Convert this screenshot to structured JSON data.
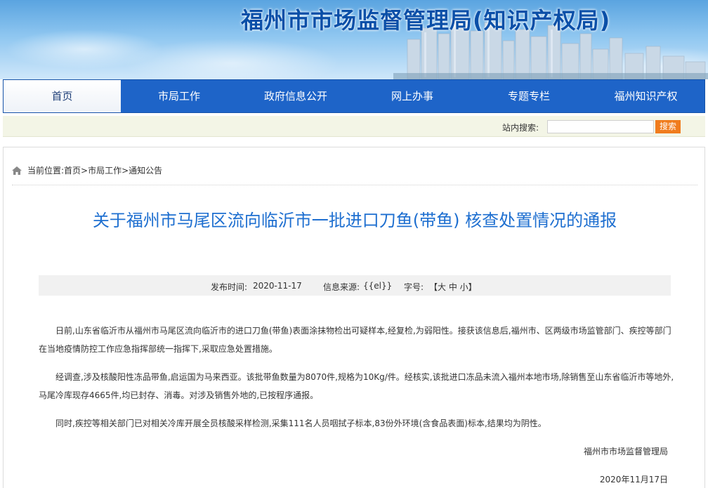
{
  "header": {
    "site_title": "福州市市场监督管理局(知识产权局)"
  },
  "nav": {
    "items": [
      "首页",
      "市局工作",
      "政府信息公开",
      "网上办事",
      "专题专栏",
      "福州知识产权"
    ]
  },
  "search": {
    "label": "站内搜索:",
    "value": "",
    "button": "搜索"
  },
  "breadcrumb": {
    "prefix": "当前位置:",
    "path": "首页>市局工作>通知公告"
  },
  "article": {
    "title": "关于福州市马尾区流向临沂市一批进口刀鱼(带鱼) 核查处置情况的通报",
    "meta": {
      "publish_label": "发布时间:",
      "publish_date": "2020-11-17",
      "source_label": "信息来源:",
      "source_value": "{{el}}",
      "font_label": "字号:",
      "font_size_text": "【大 中 小】"
    },
    "paragraphs": [
      "日前,山东省临沂市从福州市马尾区流向临沂市的进口刀鱼(带鱼)表面涂抹物检出可疑样本,经复检,为弱阳性。接获该信息后,福州市、区两级市场监管部门、疾控等部门在当地疫情防控工作应急指挥部统一指挥下,采取应急处置措施。",
      "经调查,涉及核酸阳性冻品带鱼,启运国为马来西亚。该批带鱼数量为8070件,规格为10Kg/件。经核实,该批进口冻品未流入福州本地市场,除销售至山东省临沂市等地外,马尾冷库现存4665件,均已封存、消毒。对涉及销售外地的,已按程序通报。",
      "同时,疾控等相关部门已对相关冷库开展全员核酸采样检测,采集111名人员咽拭子标本,83份外环境(含食品表面)标本,结果均为阴性。"
    ],
    "signature": "福州市市场监督管理局",
    "date": "2020年11月17日"
  },
  "colors": {
    "nav_bg": "#1e64c8",
    "title_blue": "#1e6fd0",
    "search_button": "#f07c1d"
  },
  "icons": {
    "breadcrumb": "home-icon"
  }
}
